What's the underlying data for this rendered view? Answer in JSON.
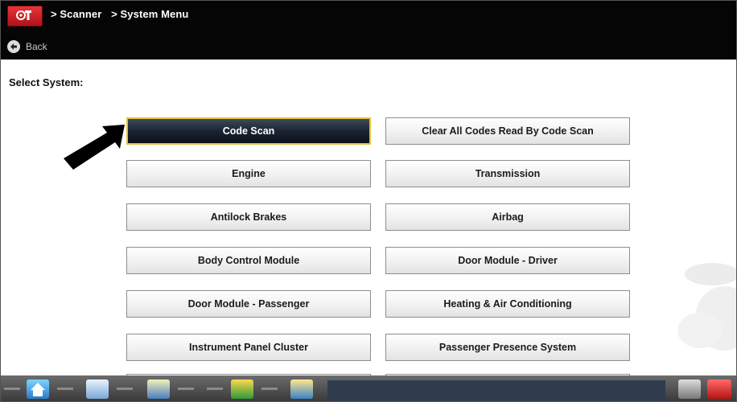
{
  "header": {
    "breadcrumbs": [
      "> Scanner",
      "> System Menu"
    ],
    "back_label": "Back"
  },
  "main": {
    "select_label": "Select System:",
    "systems": [
      {
        "label": "Code Scan",
        "selected": true
      },
      {
        "label": "Clear All Codes Read By Code Scan",
        "selected": false
      },
      {
        "label": "Engine",
        "selected": false
      },
      {
        "label": "Transmission",
        "selected": false
      },
      {
        "label": "Antilock Brakes",
        "selected": false
      },
      {
        "label": "Airbag",
        "selected": false
      },
      {
        "label": "Body Control Module",
        "selected": false
      },
      {
        "label": "Door Module - Driver",
        "selected": false
      },
      {
        "label": "Door Module - Passenger",
        "selected": false
      },
      {
        "label": "Heating & Air Conditioning",
        "selected": false
      },
      {
        "label": "Instrument Panel Cluster",
        "selected": false
      },
      {
        "label": "Passenger Presence System",
        "selected": false
      }
    ]
  },
  "taskbar": {
    "icons": [
      "home-icon",
      "vehicle-id-icon",
      "shop-manager-icon",
      "toolbox-icon",
      "folder-icon",
      "tools-icon",
      "scanner-icon"
    ]
  },
  "colors": {
    "header_bg": "#050505",
    "selected_border": "#e5c33b",
    "selected_bg": "#1b2432"
  }
}
